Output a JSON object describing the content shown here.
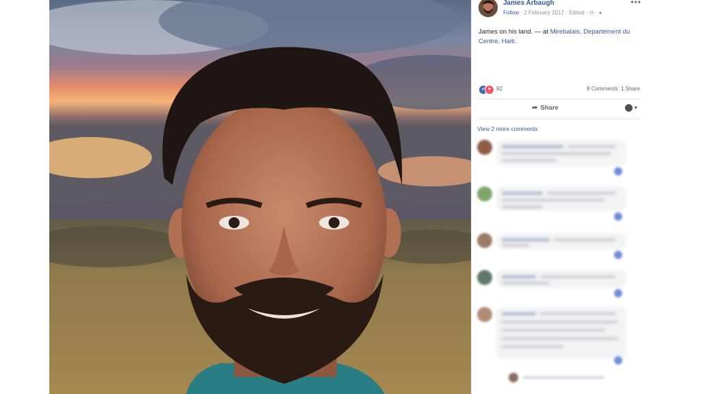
{
  "post": {
    "author": "James Arbaugh",
    "follow_label": "Follow",
    "meta_separator": " · ",
    "date": "2 February 2017",
    "edited_label": "Edited",
    "meta_icons": "· ⊙ · ●",
    "more_label": "•••",
    "text_main": "James on his land.",
    "text_dash": " — at ",
    "location": "Mirebalais, Departement du Centre, Haiti",
    "text_end": "."
  },
  "reactions": {
    "like_icon": "like-icon",
    "love_icon": "love-icon",
    "like_glyph": "✔",
    "love_glyph": "♥",
    "count": "92",
    "comments_label": "8 Comments",
    "shares_label": "1 Share"
  },
  "actions": {
    "share_label": "Share",
    "share_glyph": "➦",
    "audience_caret": "▾"
  },
  "comments": {
    "view_more_label": "View 2 more comments"
  },
  "colors": {
    "link": "#365899",
    "sky_top": "#3f4c66",
    "sunset": "#f08a5d",
    "field": "#8a7446"
  }
}
